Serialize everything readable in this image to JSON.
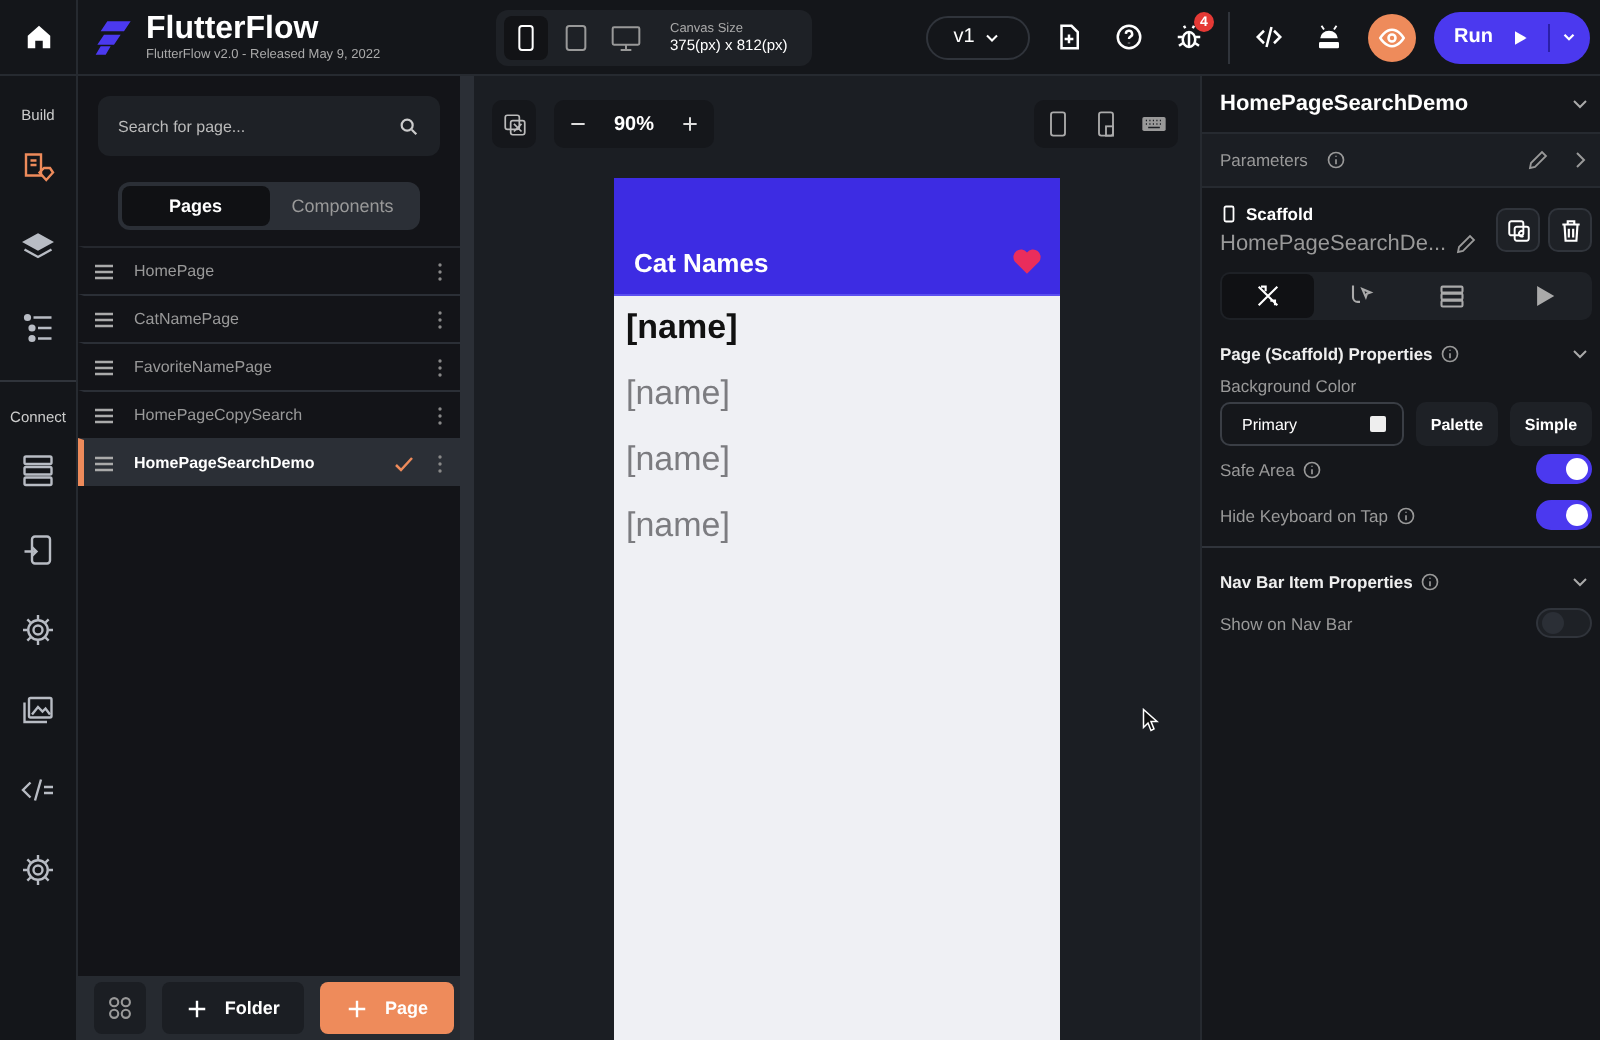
{
  "app": {
    "title": "FlutterFlow",
    "subtitle": "FlutterFlow v2.0 - Released May 9, 2022"
  },
  "devices": [
    {
      "kind": "phone",
      "selected": true
    },
    {
      "kind": "tablet",
      "selected": false
    },
    {
      "kind": "desktop",
      "selected": false
    }
  ],
  "canvas_size": {
    "label": "Canvas Size",
    "value": "375(px) x 812(px)"
  },
  "version": "v1",
  "bug_badge": "4",
  "run_button": "Run",
  "rail": [
    {
      "label": "Build",
      "items": [
        {
          "kind": "theme",
          "selected": true
        },
        {
          "kind": "layers",
          "selected": false
        },
        {
          "kind": "tree",
          "selected": false
        }
      ]
    },
    {
      "label": "Connect",
      "items": [
        {
          "kind": "database",
          "selected": false
        },
        {
          "kind": "api",
          "selected": false
        },
        {
          "kind": "custom",
          "selected": false
        },
        {
          "kind": "media",
          "selected": false
        },
        {
          "kind": "code",
          "selected": false
        },
        {
          "kind": "settings",
          "selected": false
        }
      ]
    }
  ],
  "search": {
    "placeholder": "Search for page..."
  },
  "tabs": [
    {
      "label": "Pages",
      "selected": true
    },
    {
      "label": "Components",
      "selected": false
    }
  ],
  "pages": [
    {
      "name": "HomePage",
      "selected": false
    },
    {
      "name": "CatNamePage",
      "selected": false
    },
    {
      "name": "FavoriteNamePage",
      "selected": false
    },
    {
      "name": "HomePageCopySearch",
      "selected": false
    },
    {
      "name": "HomePageSearchDemo",
      "selected": true
    }
  ],
  "folder_button": "Folder",
  "page_button": "Page",
  "zoom": "90%",
  "preview": {
    "app_bar_title": "Cat Names",
    "items": [
      {
        "text": "[name]",
        "emphasized": true
      },
      {
        "text": "[name]",
        "emphasized": false
      },
      {
        "text": "[name]",
        "emphasized": false
      },
      {
        "text": "[name]",
        "emphasized": false
      }
    ]
  },
  "properties": {
    "page_name": "HomePageSearchDemo",
    "parameters": "Parameters",
    "widget_type": "Scaffold",
    "widget_name": "HomePageSearchDe...",
    "tabs": [
      {
        "kind": "style",
        "selected": true
      },
      {
        "kind": "actions",
        "selected": false
      },
      {
        "kind": "backend",
        "selected": false
      },
      {
        "kind": "play",
        "selected": false
      }
    ],
    "section_title": "Page (Scaffold) Properties",
    "background_label": "Background Color",
    "color_value": "Primary",
    "palette_button": "Palette",
    "simple_button": "Simple",
    "toggles": [
      {
        "label": "Safe Area",
        "on": true
      },
      {
        "label": "Hide Keyboard on Tap",
        "on": true
      }
    ],
    "nav_section_title": "Nav Bar Item Properties",
    "nav_toggles": [
      {
        "label": "Show on Nav Bar",
        "on": false
      }
    ]
  }
}
